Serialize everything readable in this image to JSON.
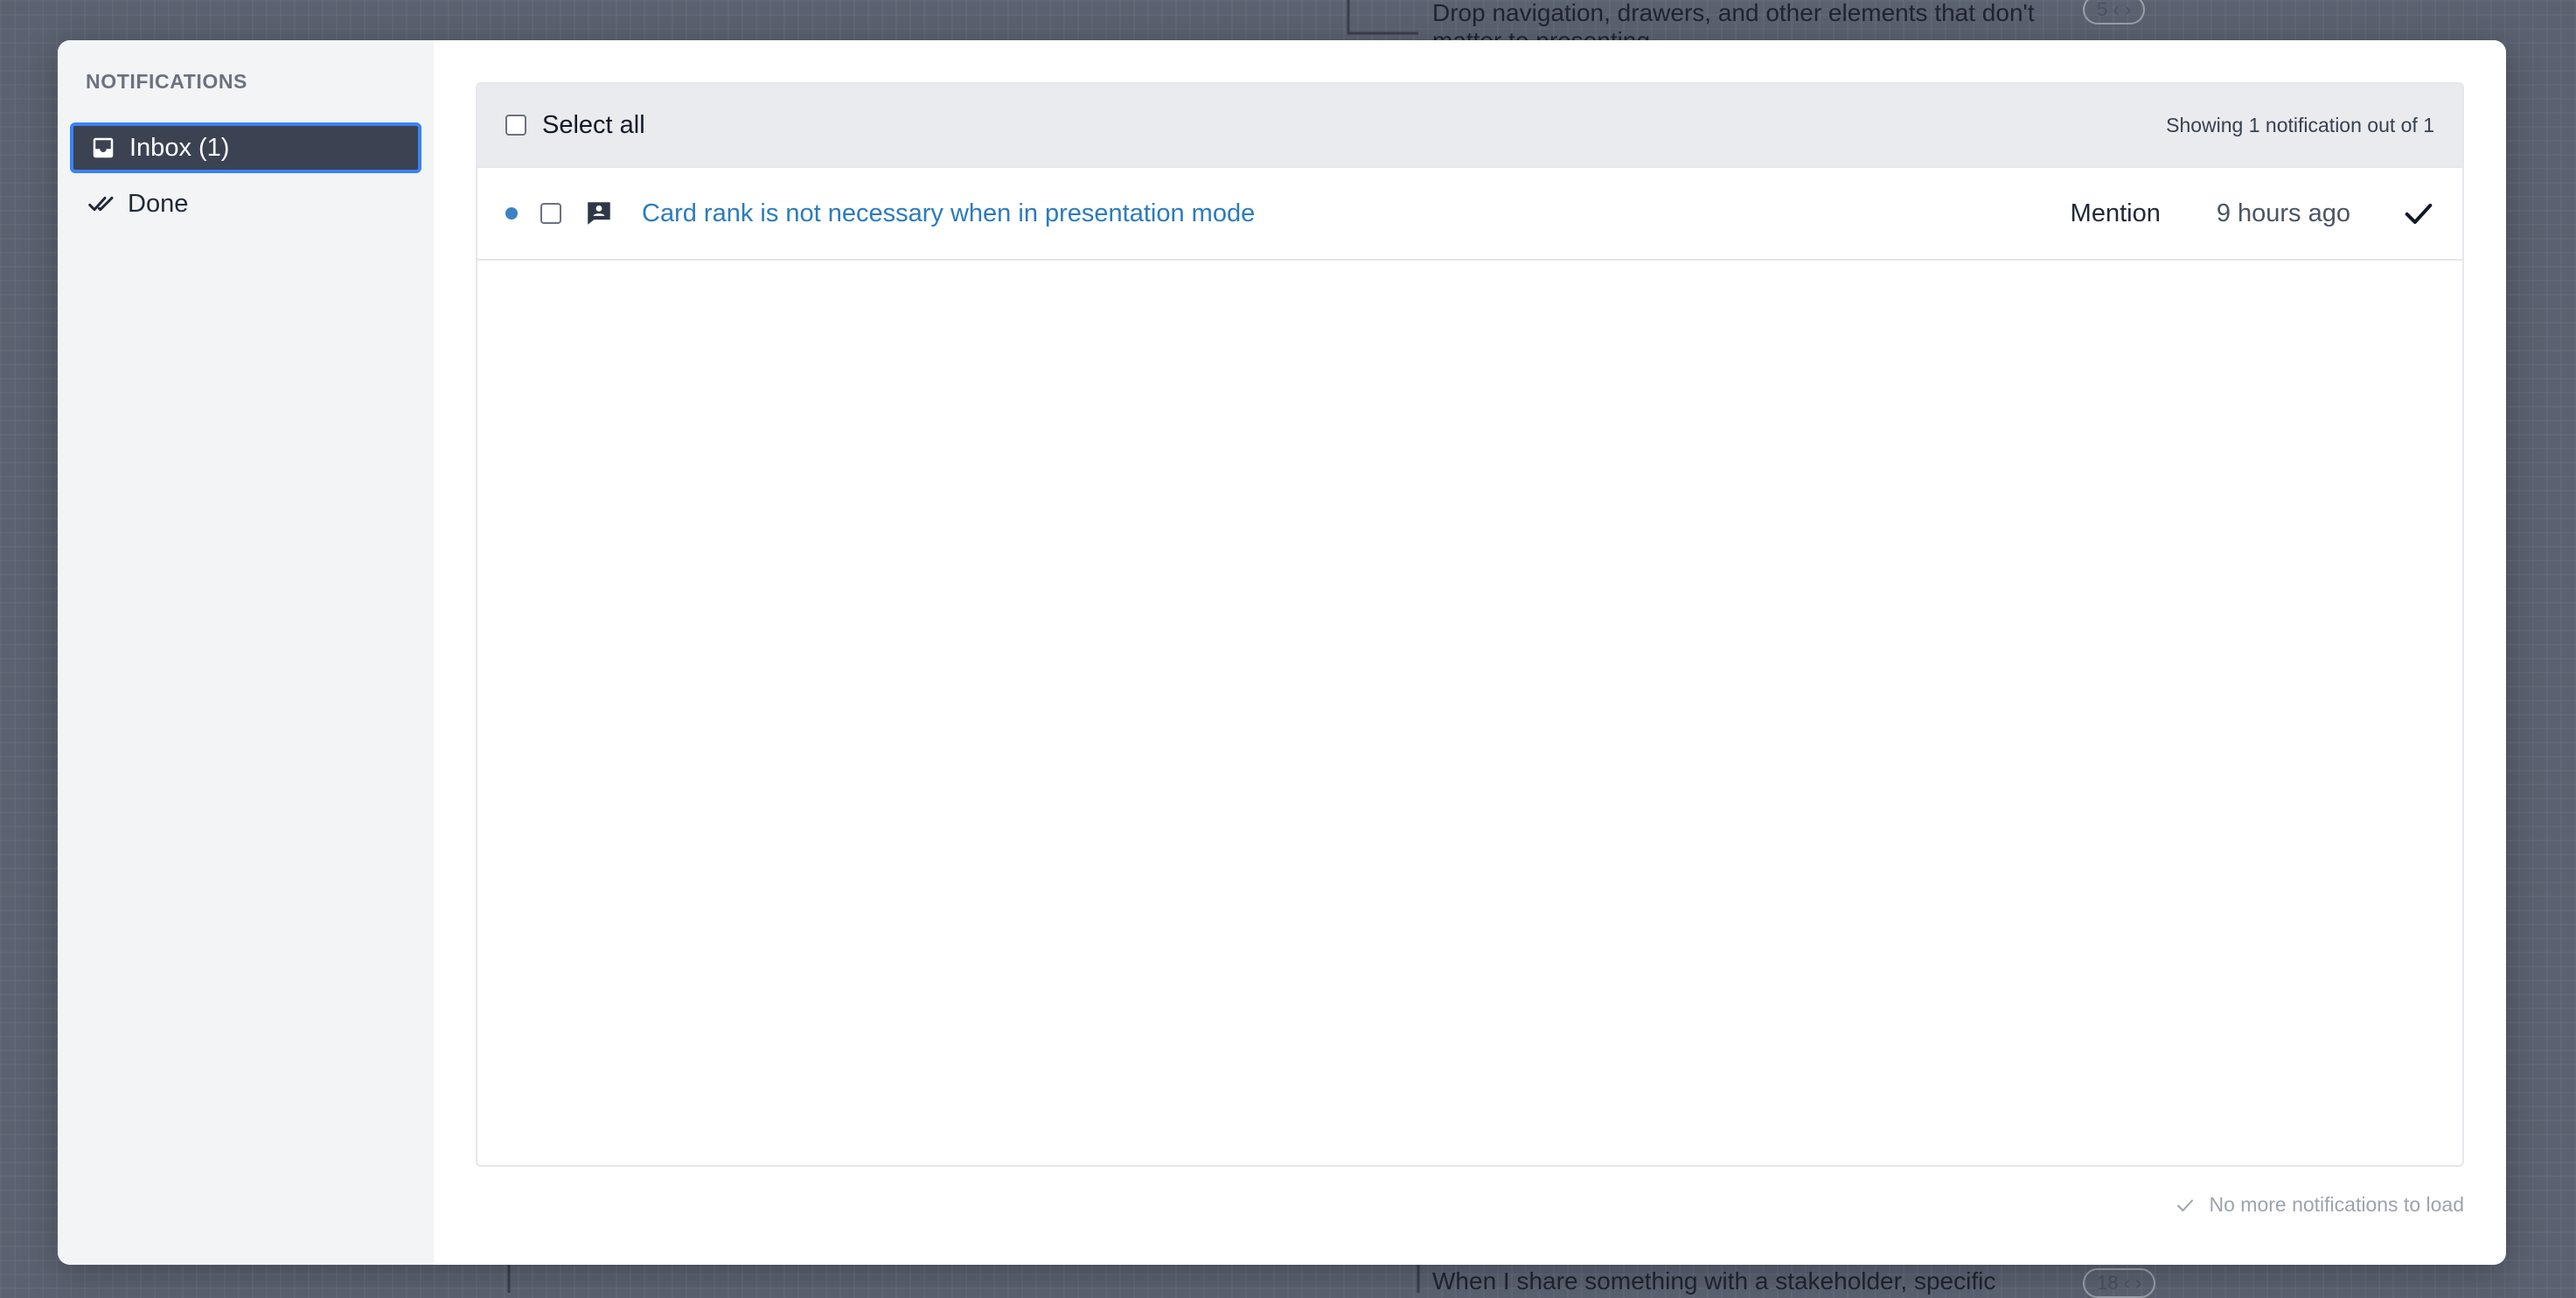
{
  "background": {
    "card_top_text_line1": "Drop navigation, drawers, and other elements that don't",
    "card_top_text_line2": "matter to presenting",
    "card_top_count": "5",
    "card_bottom_text": "When I share something with a stakeholder, specific",
    "card_bottom_count": "18"
  },
  "sidebar": {
    "heading": "NOTIFICATIONS",
    "items": [
      {
        "label": "Inbox (1)",
        "icon": "inbox-icon",
        "active": true
      },
      {
        "label": "Done",
        "icon": "double-check-icon",
        "active": false
      }
    ]
  },
  "list": {
    "select_all_label": "Select all",
    "showing_text": "Showing 1 notification out of 1",
    "rows": [
      {
        "title": "Card rank is not necessary when in presentation mode",
        "reason": "Mention",
        "time": "9 hours ago",
        "unread": true,
        "icon": "comment-person-icon"
      }
    ]
  },
  "footer": {
    "note": "No more notifications to load"
  },
  "colors": {
    "accent_border": "#3b82f6",
    "active_nav_bg": "#3b4252",
    "link": "#2b7bbd",
    "unread_dot": "#3b82c4"
  }
}
